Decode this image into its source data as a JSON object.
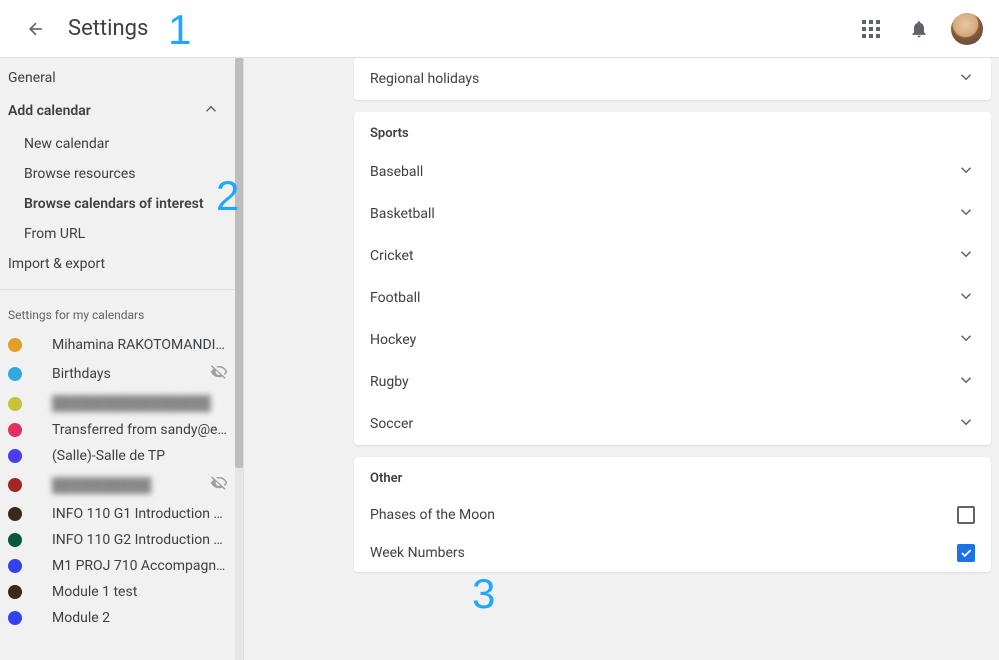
{
  "header": {
    "title": "Settings"
  },
  "annotations": {
    "a1": "1",
    "a2": "2",
    "a3": "3"
  },
  "sidebar": {
    "nav": {
      "general": "General",
      "add_calendar": "Add calendar",
      "new_calendar": "New calendar",
      "browse_resources": "Browse resources",
      "browse_interest": "Browse calendars of interest",
      "from_url": "From URL",
      "import_export": "Import & export"
    },
    "my_cals_label": "Settings for my calendars",
    "calendars": [
      {
        "name": "Mihamina RAKOTOMANDI…",
        "color": "#e0a028",
        "hidden": false,
        "blur": false
      },
      {
        "name": "Birthdays",
        "color": "#33aadd",
        "hidden": true,
        "blur": false
      },
      {
        "name": "████████████████",
        "color": "#c6c23a",
        "hidden": false,
        "blur": true
      },
      {
        "name": "Transferred from sandy@e…",
        "color": "#e4305e",
        "hidden": false,
        "blur": false
      },
      {
        "name": "(Salle)-Salle de TP",
        "color": "#4a3fef",
        "hidden": false,
        "blur": false
      },
      {
        "name": "██████████",
        "color": "#a02820",
        "hidden": true,
        "blur": true
      },
      {
        "name": "INFO 110 G1 Introduction …",
        "color": "#3a2a1a",
        "hidden": false,
        "blur": false
      },
      {
        "name": "INFO 110 G2 Introduction …",
        "color": "#0a5a3a",
        "hidden": false,
        "blur": false
      },
      {
        "name": "M1 PROJ 710 Accompagn…",
        "color": "#3344ee",
        "hidden": false,
        "blur": false
      },
      {
        "name": "Module 1 test",
        "color": "#3a2a1a",
        "hidden": false,
        "blur": false
      },
      {
        "name": "Module 2",
        "color": "#3344ee",
        "hidden": false,
        "blur": false
      }
    ]
  },
  "main": {
    "top_card": {
      "regional": "Regional holidays"
    },
    "sports": {
      "title": "Sports",
      "items": [
        "Baseball",
        "Basketball",
        "Cricket",
        "Football",
        "Hockey",
        "Rugby",
        "Soccer"
      ]
    },
    "other": {
      "title": "Other",
      "items": [
        {
          "label": "Phases of the Moon",
          "checked": false
        },
        {
          "label": "Week Numbers",
          "checked": true
        }
      ]
    }
  }
}
